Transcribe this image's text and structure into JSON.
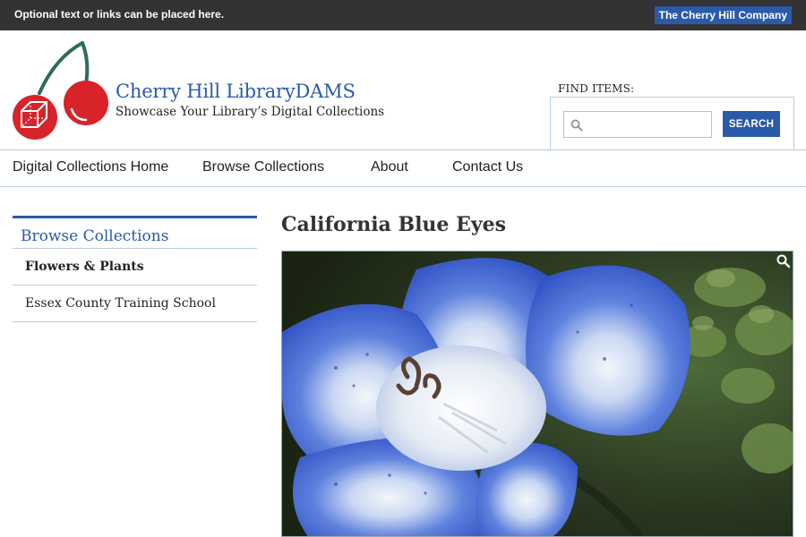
{
  "topbar": {
    "text": "Optional text or links can be placed here.",
    "company_link": "The Cherry Hill Company"
  },
  "header": {
    "site_title": "Cherry Hill LibraryDAMS",
    "tagline": "Showcase Your Library’s Digital Collections",
    "logo_icon": "cherry-logo-icon"
  },
  "search": {
    "label": "FIND ITEMS:",
    "placeholder": "",
    "value": "",
    "button_label": "SEARCH",
    "icon": "search-icon"
  },
  "nav": {
    "items": [
      {
        "label": "Digital Collections Home"
      },
      {
        "label": "Browse Collections"
      },
      {
        "label": "About"
      },
      {
        "label": "Contact Us"
      }
    ]
  },
  "sidebar": {
    "heading": "Browse Collections",
    "items": [
      {
        "label": "Flowers & Plants",
        "active": true
      },
      {
        "label": "Essex County Training School",
        "active": false
      }
    ]
  },
  "main": {
    "title": "California Blue Eyes",
    "image_icon": "zoom-icon"
  },
  "colors": {
    "topbar_bg": "#333333",
    "brand_blue": "#2a5aa8",
    "divider": "#b9cde0",
    "cherry_red": "#d8232a",
    "stem_green": "#2e6b5e"
  }
}
